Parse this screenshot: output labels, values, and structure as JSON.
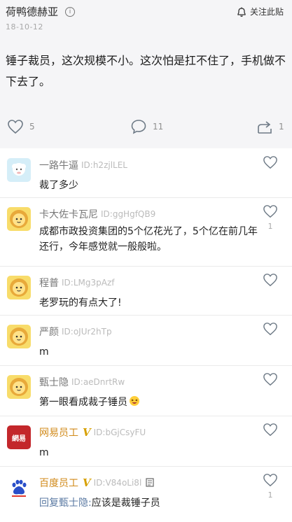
{
  "post": {
    "author": "荷鸭德赫亚",
    "info_symbol": "i",
    "follow_label": "关注此贴",
    "date": "18-10-12",
    "content": "锤子裁员，这次规模不小。这次怕是扛不住了，手机做不下去了。",
    "likes": "5",
    "comments": "11",
    "shares": "1"
  },
  "comments": [
    {
      "name": "一路牛逼",
      "id": "ID:h2zjlLEL",
      "text": "裁了多少",
      "avatar": "sheep-icon",
      "likes": ""
    },
    {
      "name": "卡大佐卡瓦尼",
      "id": "ID:ggHgfQB9",
      "text": "成都市政投资集团的5个亿花光了，5个亿在前几年还行，今年感觉就一般般啦。",
      "avatar": "lion-icon",
      "likes": "1"
    },
    {
      "name": "程普",
      "id": "ID:LMg3pAzf",
      "text": "老罗玩的有点大了!",
      "avatar": "lion-icon",
      "likes": ""
    },
    {
      "name": "严颜",
      "id": "ID:oJUr2hTp",
      "text": "m",
      "avatar": "lion-icon",
      "likes": ""
    },
    {
      "name": "甄士隐",
      "id": "ID:aeDnrtRw",
      "text": "第一眼看成裁子锤员",
      "avatar": "lion-icon",
      "likes": ""
    },
    {
      "name": "网易员工",
      "verified": "V",
      "id": "ID:bGjCsyFU",
      "text": "m",
      "avatar": "netease-logo",
      "avatar_text": "網易",
      "likes": ""
    },
    {
      "name": "百度员工",
      "verified": "V",
      "id": "ID:V84oLi8l",
      "reply_to": "回复甄士隐:",
      "text": "应该是裁锤子员",
      "avatar": "baidu-logo",
      "likes": "1"
    }
  ],
  "colors": {
    "accent_gold": "#d18a1a",
    "netease_red": "#c3272b",
    "reply_blue": "#5b7aa3"
  }
}
